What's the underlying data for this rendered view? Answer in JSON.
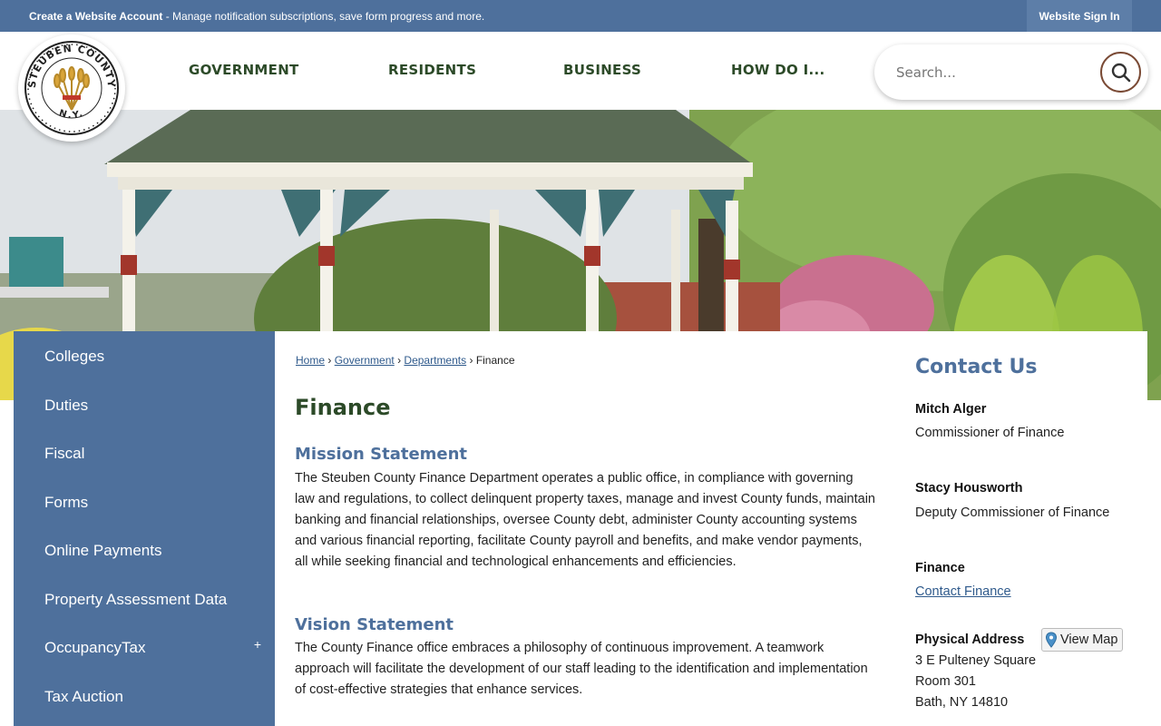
{
  "topbar": {
    "create_account_bold": "Create a Website Account",
    "create_account_rest": " - Manage notification subscriptions, save form progress and more.",
    "sign_in": "Website Sign In"
  },
  "logo": {
    "text_top": "STEUBEN COUNTY",
    "text_bottom": "N.Y."
  },
  "nav": {
    "items": [
      "GOVERNMENT",
      "RESIDENTS",
      "BUSINESS",
      "HOW DO I..."
    ]
  },
  "search": {
    "placeholder": "Search..."
  },
  "sidebar": {
    "items": [
      "Colleges",
      "Duties",
      "Fiscal",
      "Forms",
      "Online Payments",
      "Property Assessment Data",
      "OccupancyTax",
      "Tax Auction"
    ],
    "expand_symbol": "+"
  },
  "breadcrumb": {
    "home": "Home",
    "government": "Government",
    "departments": "Departments",
    "current": "Finance",
    "separator": "›"
  },
  "page": {
    "title": "Finance",
    "mission_heading": "Mission Statement",
    "mission_text": "The Steuben County Finance Department operates a public office, in compliance with governing law and regulations, to collect delinquent property taxes, manage and invest County funds, maintain banking and financial relationships, oversee County debt, administer County accounting systems and various financial reporting, facilitate County payroll and benefits, and make vendor payments, all while seeking financial and technological enhancements and efficiencies.",
    "vision_heading": "Vision Statement",
    "vision_text": "The County Finance office embraces a philosophy of continuous improvement. A teamwork approach will facilitate the development of our staff leading to the identification and implementation of cost-effective strategies that enhance services."
  },
  "contact": {
    "title": "Contact Us",
    "person1_name": "Mitch Alger",
    "person1_role": "Commissioner of Finance",
    "person2_name": "Stacy Housworth",
    "person2_role": "Deputy Commissioner of Finance",
    "dept_name": "Finance",
    "dept_link": "Contact Finance",
    "address_label": "Physical Address",
    "view_map": "View Map",
    "address_line1": "3 E Pulteney Square",
    "address_line2": "Room 301",
    "address_line3": "Bath, NY 14810"
  },
  "colors": {
    "blue": "#4e709c",
    "green": "#2c4a28",
    "link": "#2f5a8c"
  }
}
